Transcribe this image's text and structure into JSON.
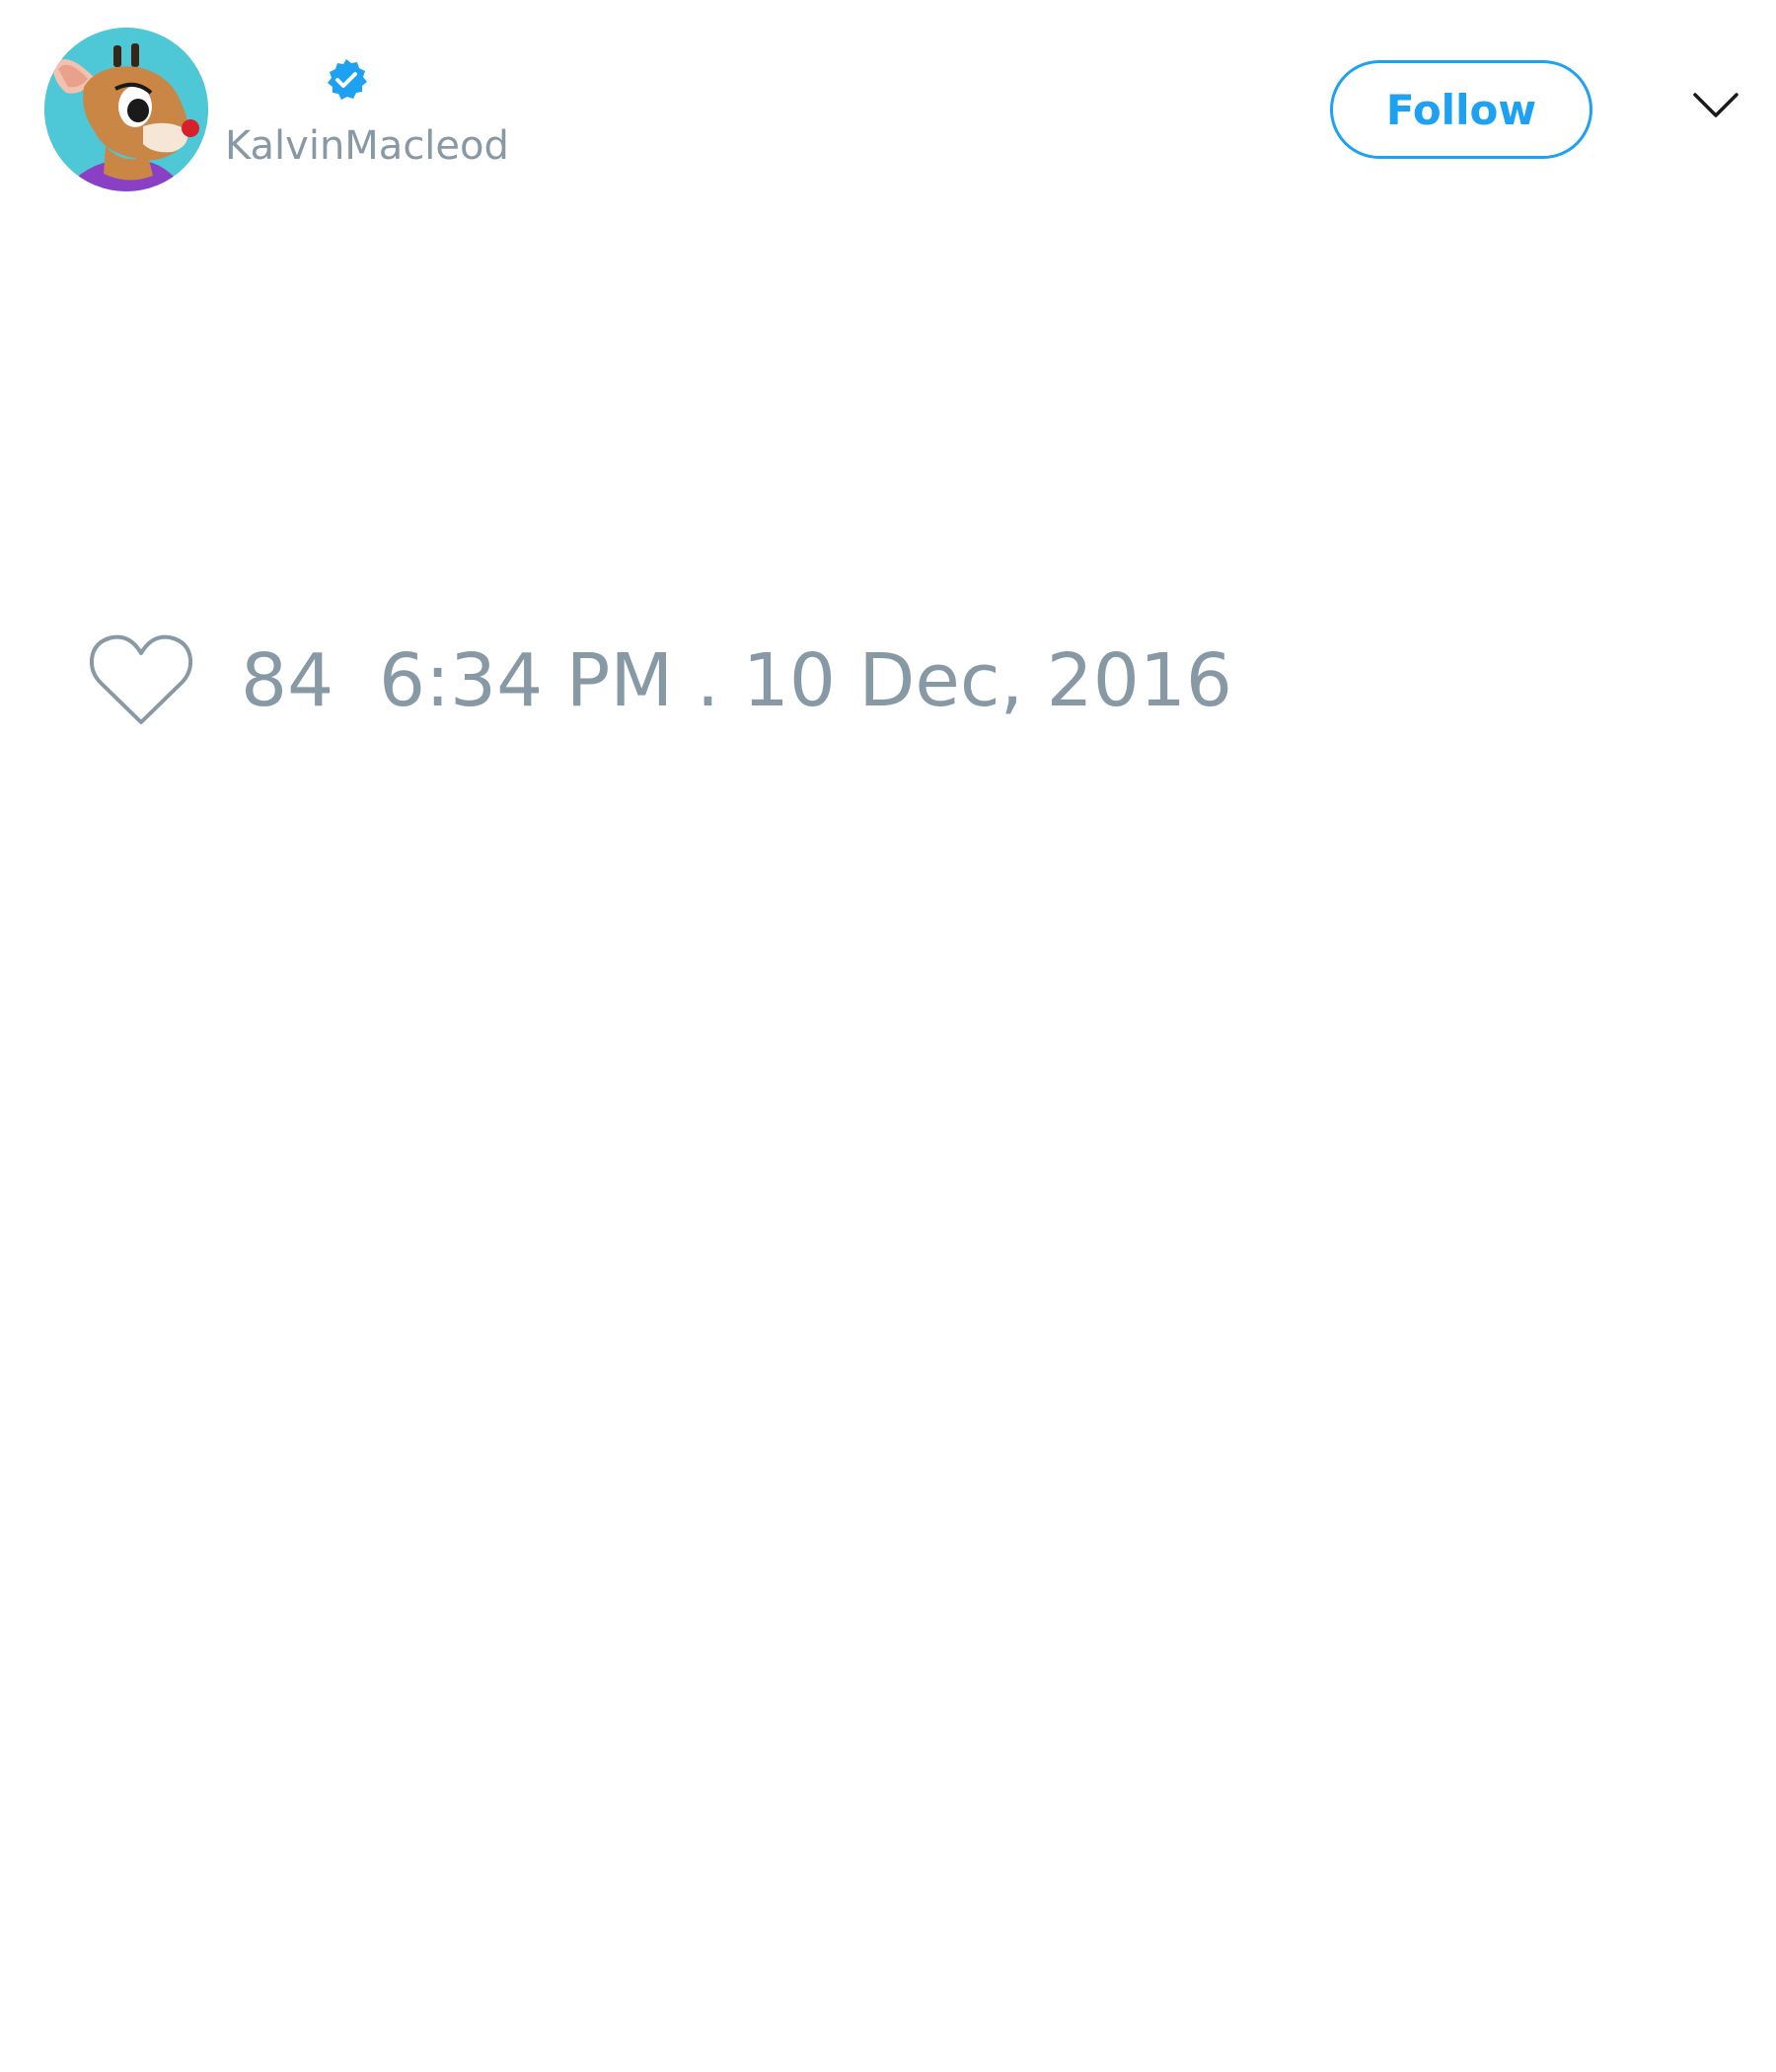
{
  "user": {
    "handle": "KalvinMacleod",
    "verified": true,
    "avatar_icon": "reindeer-avatar-icon",
    "verified_icon": "verified-badge-icon"
  },
  "header": {
    "follow_label": "Follow",
    "menu_icon": "chevron-down-icon"
  },
  "actions": {
    "like_icon": "heart-icon",
    "like_count": "84",
    "timestamp": "6:34 PM . 10 Dec, 2016"
  },
  "colors": {
    "accent": "#1da1f2",
    "muted_text": "#8899a6",
    "background": "#ffffff"
  }
}
